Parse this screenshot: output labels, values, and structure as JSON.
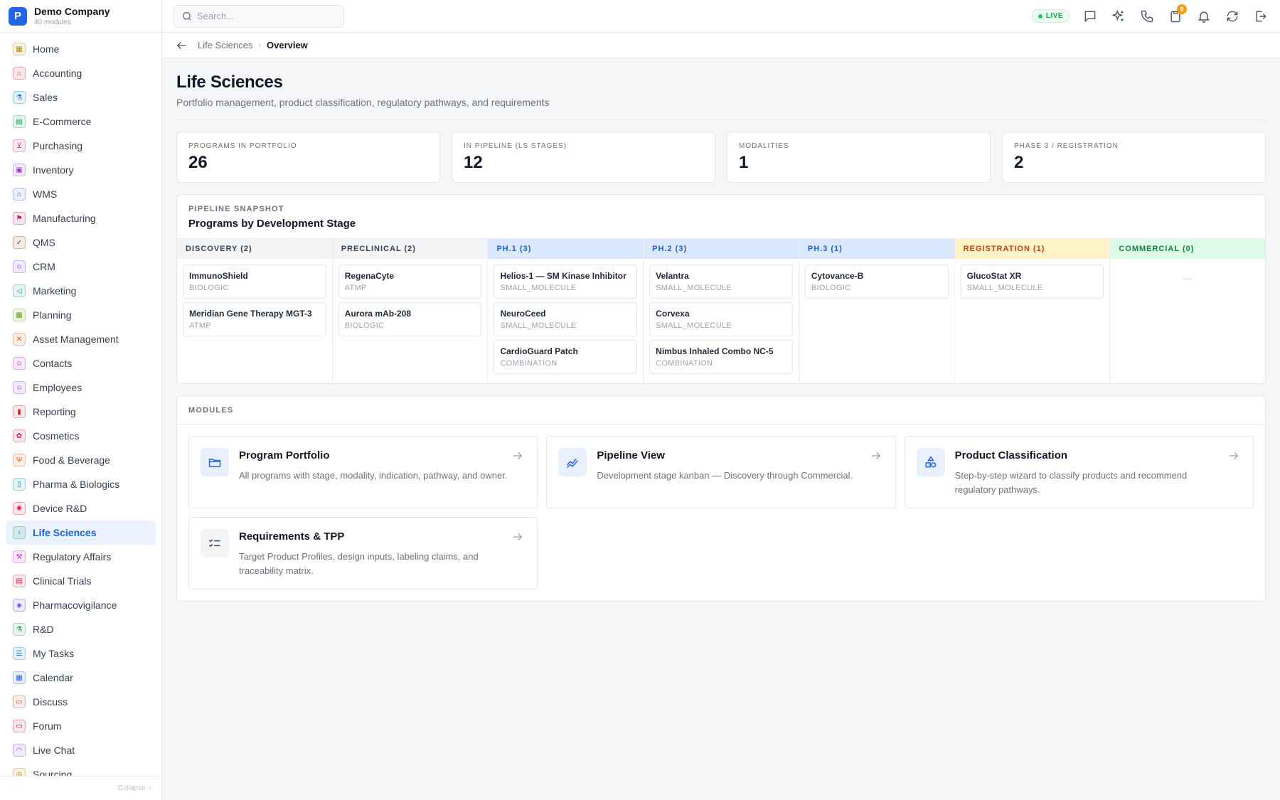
{
  "brand": {
    "logo_letter": "P",
    "name": "Demo Company",
    "subtitle": "40 modules"
  },
  "sidebar": {
    "items": [
      {
        "label": "Home",
        "icon": "grid-icon",
        "color": "#b8860b"
      },
      {
        "label": "Accounting",
        "icon": "bank-icon",
        "color": "#dc2626"
      },
      {
        "label": "Sales",
        "icon": "flask-icon",
        "color": "#0284c7"
      },
      {
        "label": "E-Commerce",
        "icon": "store-icon",
        "color": "#16a34a"
      },
      {
        "label": "Purchasing",
        "icon": "cart-icon",
        "color": "#db2777"
      },
      {
        "label": "Inventory",
        "icon": "box-icon",
        "color": "#9333ea"
      },
      {
        "label": "WMS",
        "icon": "warehouse-icon",
        "color": "#2563eb"
      },
      {
        "label": "Manufacturing",
        "icon": "factory-icon",
        "color": "#be185d"
      },
      {
        "label": "QMS",
        "icon": "check-badge-icon",
        "color": "#92400e"
      },
      {
        "label": "CRM",
        "icon": "people-icon",
        "color": "#7c3aed"
      },
      {
        "label": "Marketing",
        "icon": "megaphone-icon",
        "color": "#0d9488"
      },
      {
        "label": "Planning",
        "icon": "calendar-grid-icon",
        "color": "#65a30d"
      },
      {
        "label": "Asset Management",
        "icon": "tools-icon",
        "color": "#ea580c"
      },
      {
        "label": "Contacts",
        "icon": "contact-icon",
        "color": "#c026d3"
      },
      {
        "label": "Employees",
        "icon": "employee-icon",
        "color": "#9333ea"
      },
      {
        "label": "Reporting",
        "icon": "bar-chart-icon",
        "color": "#dc2626"
      },
      {
        "label": "Cosmetics",
        "icon": "lotus-icon",
        "color": "#e11d48"
      },
      {
        "label": "Food & Beverage",
        "icon": "utensils-icon",
        "color": "#ea580c"
      },
      {
        "label": "Pharma & Biologics",
        "icon": "vial-icon",
        "color": "#0891b2"
      },
      {
        "label": "Device R&D",
        "icon": "chip-icon",
        "color": "#e11d48"
      },
      {
        "label": "Life Sciences",
        "icon": "microscope-icon",
        "color": "#16a34a"
      },
      {
        "label": "Regulatory Affairs",
        "icon": "gavel-icon",
        "color": "#c026d3"
      },
      {
        "label": "Clinical Trials",
        "icon": "clipboard-icon",
        "color": "#e11d48"
      },
      {
        "label": "Pharmacovigilance",
        "icon": "shield-icon",
        "color": "#4f46e5"
      },
      {
        "label": "R&D",
        "icon": "beaker-icon",
        "color": "#16a34a"
      },
      {
        "label": "My Tasks",
        "icon": "tasks-icon",
        "color": "#0284c7"
      },
      {
        "label": "Calendar",
        "icon": "calendar-icon",
        "color": "#2563eb"
      },
      {
        "label": "Discuss",
        "icon": "chat-icon",
        "color": "#b45309"
      },
      {
        "label": "Forum",
        "icon": "forum-icon",
        "color": "#be185d"
      },
      {
        "label": "Live Chat",
        "icon": "headset-icon",
        "color": "#7c3aed"
      },
      {
        "label": "Sourcing",
        "icon": "sourcing-icon",
        "color": "#b8860b"
      }
    ],
    "active_index": 20,
    "collapse_label": "Collapse"
  },
  "header": {
    "search_placeholder": "Search...",
    "live_label": "LIVE",
    "notification_count": "9"
  },
  "breadcrumb": {
    "parent": "Life Sciences",
    "current": "Overview"
  },
  "page": {
    "title": "Life Sciences",
    "subtitle": "Portfolio management, product classification, regulatory pathways, and requirements"
  },
  "stats": [
    {
      "label": "Programs in Portfolio",
      "value": "26"
    },
    {
      "label": "In Pipeline (LS Stages)",
      "value": "12"
    },
    {
      "label": "Modalities",
      "value": "1"
    },
    {
      "label": "Phase 3 / Registration",
      "value": "2"
    }
  ],
  "pipeline": {
    "eyebrow": "Pipeline Snapshot",
    "title": "Programs by Development Stage",
    "columns": [
      {
        "label": "Discovery (2)",
        "bg": "#f3f4f6",
        "fg": "#374151",
        "cards": [
          {
            "name": "ImmunoShield",
            "modality": "BIOLOGIC"
          },
          {
            "name": "Meridian Gene Therapy MGT-3",
            "modality": "ATMP"
          }
        ]
      },
      {
        "label": "Preclinical (2)",
        "bg": "#f3f4f6",
        "fg": "#374151",
        "cards": [
          {
            "name": "RegenaCyte",
            "modality": "ATMP"
          },
          {
            "name": "Aurora mAb-208",
            "modality": "BIOLOGIC"
          }
        ]
      },
      {
        "label": "Ph.1 (3)",
        "bg": "#dbe8fe",
        "fg": "#1d5fd6",
        "cards": [
          {
            "name": "Helios-1 — SM Kinase Inhibitor",
            "modality": "SMALL_MOLECULE"
          },
          {
            "name": "NeuroCeed",
            "modality": "SMALL_MOLECULE"
          },
          {
            "name": "CardioGuard Patch",
            "modality": "COMBINATION"
          }
        ]
      },
      {
        "label": "Ph.2 (3)",
        "bg": "#dbe8fe",
        "fg": "#1d5fd6",
        "cards": [
          {
            "name": "Velantra",
            "modality": "SMALL_MOLECULE"
          },
          {
            "name": "Corvexa",
            "modality": "SMALL_MOLECULE"
          },
          {
            "name": "Nimbus Inhaled Combo NC-5",
            "modality": "COMBINATION"
          }
        ]
      },
      {
        "label": "Ph.3 (1)",
        "bg": "#dbe8fe",
        "fg": "#1d5fd6",
        "cards": [
          {
            "name": "Cytovance-B",
            "modality": "BIOLOGIC"
          }
        ]
      },
      {
        "label": "Registration (1)",
        "bg": "#fef3c7",
        "fg": "#c2410c",
        "cards": [
          {
            "name": "GlucoStat XR",
            "modality": "SMALL_MOLECULE"
          }
        ]
      },
      {
        "label": "Commercial (0)",
        "bg": "#dcfce7",
        "fg": "#15803d",
        "cards": [],
        "empty_text": "—"
      }
    ]
  },
  "modules": {
    "eyebrow": "Modules",
    "items": [
      {
        "title": "Program Portfolio",
        "desc": "All programs with stage, modality, indication, pathway, and owner.",
        "icon": "folder-icon",
        "color": "#2563eb",
        "bg": "#e8f0fe"
      },
      {
        "title": "Pipeline View",
        "desc": "Development stage kanban — Discovery through Commercial.",
        "icon": "trend-icon",
        "color": "#2563eb",
        "bg": "#e8f0fe"
      },
      {
        "title": "Product Classification",
        "desc": "Step-by-step wizard to classify products and recommend regulatory pathways.",
        "icon": "shapes-icon",
        "color": "#2563eb",
        "bg": "#e8f0fe"
      },
      {
        "title": "Requirements & TPP",
        "desc": "Target Product Profiles, design inputs, labeling claims, and traceability matrix.",
        "icon": "checklist-icon",
        "color": "#374151",
        "bg": "#f3f4f6"
      }
    ]
  }
}
